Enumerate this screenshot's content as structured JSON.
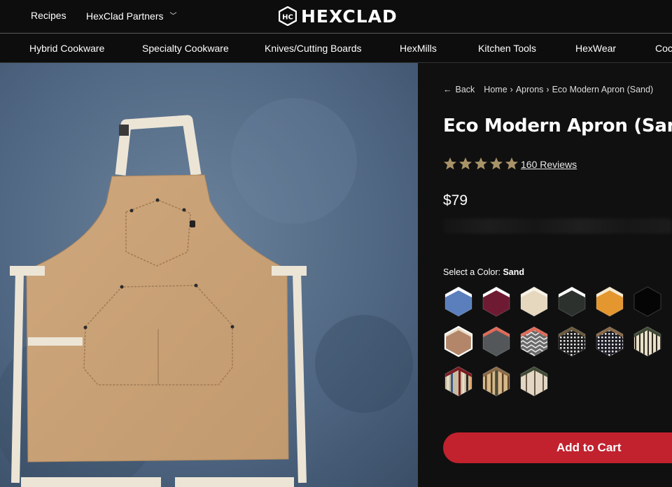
{
  "topbar": {
    "links": [
      "Recipes",
      "HexClad Partners"
    ],
    "brand": "HEXCLAD",
    "brand_logo_letters": "HC"
  },
  "categories": [
    "Hybrid Cookware",
    "Specialty Cookware",
    "Knives/Cutting Boards",
    "HexMills",
    "Kitchen Tools",
    "HexWear",
    "Cock"
  ],
  "breadcrumb": {
    "back": "Back",
    "items": [
      "Home",
      "Aprons",
      "Eco Modern Apron (Sand)"
    ],
    "separator": "›"
  },
  "product": {
    "title": "Eco Modern Apron (Sand)",
    "rating": 5,
    "reviews": "160 Reviews",
    "price": "$79",
    "color_label": "Select a Color:",
    "selected_color": "Sand",
    "add_to_cart": "Add to Cart"
  },
  "swatches": [
    {
      "name": "blue",
      "colors": [
        "#5b7fbd"
      ],
      "tab": "#ffffff"
    },
    {
      "name": "burgundy",
      "colors": [
        "#6e1a33"
      ],
      "tab": "#ffffff"
    },
    {
      "name": "cream",
      "colors": [
        "#e6d8bf"
      ],
      "tab": "#f7f2e6"
    },
    {
      "name": "charcoal",
      "colors": [
        "#2c312d"
      ],
      "tab": "#ffffff"
    },
    {
      "name": "orange",
      "colors": [
        "#e4962f"
      ],
      "tab": "#f5ead0"
    },
    {
      "name": "black",
      "colors": [
        "#050505"
      ],
      "tab": "#050505"
    },
    {
      "name": "sand",
      "colors": [
        "#b3866a"
      ],
      "tab": "#e9dcc6",
      "selected": true
    },
    {
      "name": "slate-coral",
      "colors": [
        "#53575a"
      ],
      "tab": "#e16a57"
    },
    {
      "name": "pattern-coral",
      "colors": [
        "#6b6b6b"
      ],
      "tab": "#e16a57",
      "pattern": "zigzag"
    },
    {
      "name": "houndstooth",
      "colors": [
        "#1a1a1a"
      ],
      "tab": "#6a5a3e",
      "pattern": "houndstooth"
    },
    {
      "name": "houndstooth-navy",
      "colors": [
        "#1a1a24"
      ],
      "tab": "#8a6a48",
      "pattern": "houndstooth"
    },
    {
      "name": "stripe-cream",
      "colors": [
        "#e8e0c8"
      ],
      "tab": "#3e4a36",
      "pattern": "stripes"
    },
    {
      "name": "stripe-multi",
      "colors": [
        "#c8bca0"
      ],
      "tab": "#7a1a22",
      "pattern": "multistripe"
    },
    {
      "name": "stripe-tan",
      "colors": [
        "#d6b98a"
      ],
      "tab": "#8a6a48",
      "pattern": "tanstripe"
    },
    {
      "name": "stripe-sage",
      "colors": [
        "#e2d6c4"
      ],
      "tab": "#3e4a36",
      "pattern": "sagestripe"
    }
  ],
  "accent": "#c1222e",
  "star_color": "#a89268"
}
